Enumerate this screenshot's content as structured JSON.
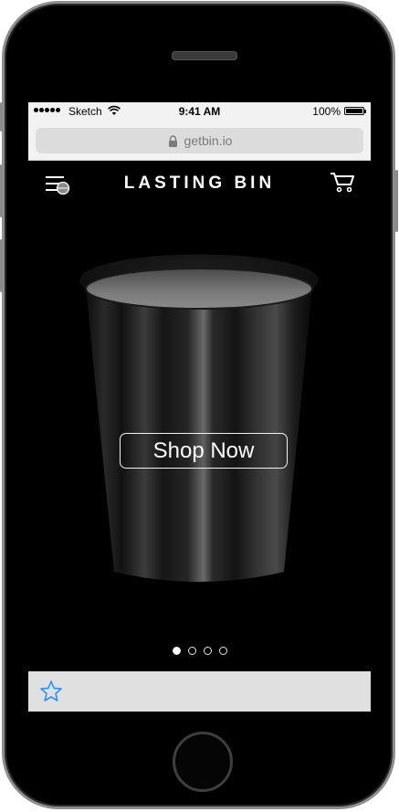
{
  "status_bar": {
    "carrier": "Sketch",
    "time": "9:41 AM",
    "battery": "100%",
    "battery_level": 1.0,
    "signal_icon": "signal-dots-icon",
    "wifi_icon": "wifi-icon"
  },
  "browser": {
    "url": "getbin.io",
    "lock_icon": "lock-icon"
  },
  "navbar": {
    "brand": "LASTING BIN",
    "menu_icon": "hamburger-menu-icon",
    "cart_icon": "cart-icon"
  },
  "hero": {
    "cta_label": "Shop Now",
    "image": "black-cup-bin",
    "carousel": {
      "total": 4,
      "active": 1
    }
  },
  "bottom_bar": {
    "favorite_icon": "star-icon"
  },
  "colors": {
    "background": "#000000",
    "text": "#ffffff",
    "accent": "#2f8ff5",
    "bottom_bar": "#e0e0e0",
    "status_bar": "#f2f2f2"
  }
}
